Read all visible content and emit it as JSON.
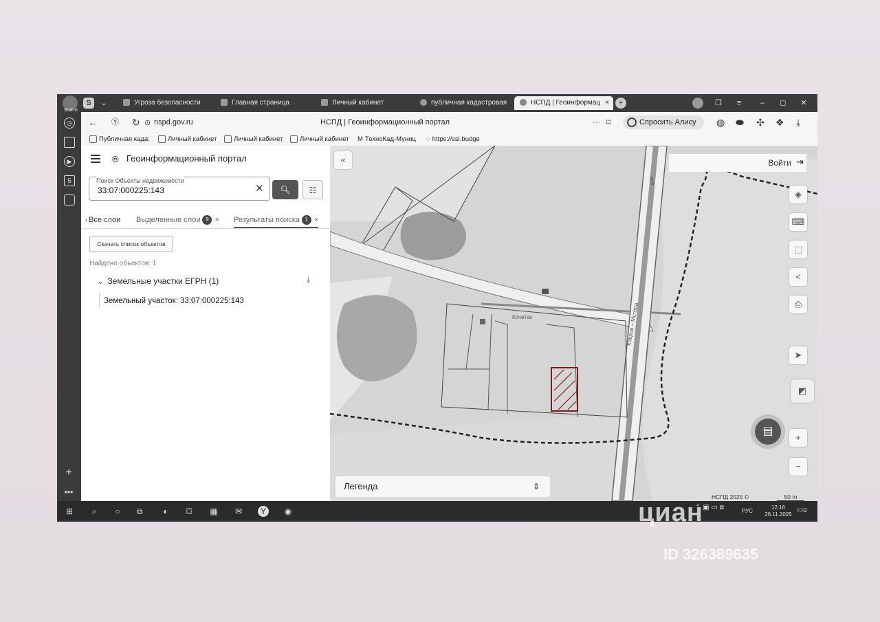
{
  "browser": {
    "profile_label": "Войти",
    "tabs": [
      {
        "label": "Угроза безопасности"
      },
      {
        "label": "Главная страница"
      },
      {
        "label": "Личный кабинет"
      },
      {
        "label": "публичная кадастровая"
      },
      {
        "label": "НСПД | Геоинформац"
      }
    ],
    "url": "nspd.gov.ru",
    "page_title": "НСПД | Геоинформационный портал",
    "alice_button": "Спросить Алису AI",
    "bookmarks": [
      {
        "label": "Публичная када:"
      },
      {
        "label": "Личный кабинет"
      },
      {
        "label": "Личный кабинет"
      },
      {
        "label": "Личный кабинет"
      },
      {
        "label": "ТехноКад-Муниц"
      },
      {
        "label": "https://ssl.budge"
      }
    ]
  },
  "panel": {
    "title": "Геоинформационный портал",
    "search": {
      "label": "Поиск Объекты недвижимости",
      "value": "33:07:000225:143"
    },
    "tabs": [
      {
        "label": "Все слои"
      },
      {
        "label": "Выделенные слои",
        "badge": "9"
      },
      {
        "label": "Результаты поиска",
        "badge": "1"
      }
    ],
    "download_button": "Скачать список объектов",
    "found_text": "Найдено объектов: 1",
    "group_label": "Земельные участки ЕГРН (1)",
    "result_item": "Земельный участок: 33:07:000225:143"
  },
  "map": {
    "login_label": "Войти",
    "legend_label": "Легенда",
    "street_label_1": "Кочетка",
    "road_label": "Ковров – Мстера",
    "road_label_2": "вов",
    "copyright": "НСПД 2025 ©",
    "scale": "50 m"
  },
  "taskbar": {
    "lang": "РУС",
    "time": "12:16",
    "date": "26.11.2025",
    "notif_count": "2"
  },
  "watermark": {
    "brand": "циан",
    "id_text": "ID 326389635"
  }
}
